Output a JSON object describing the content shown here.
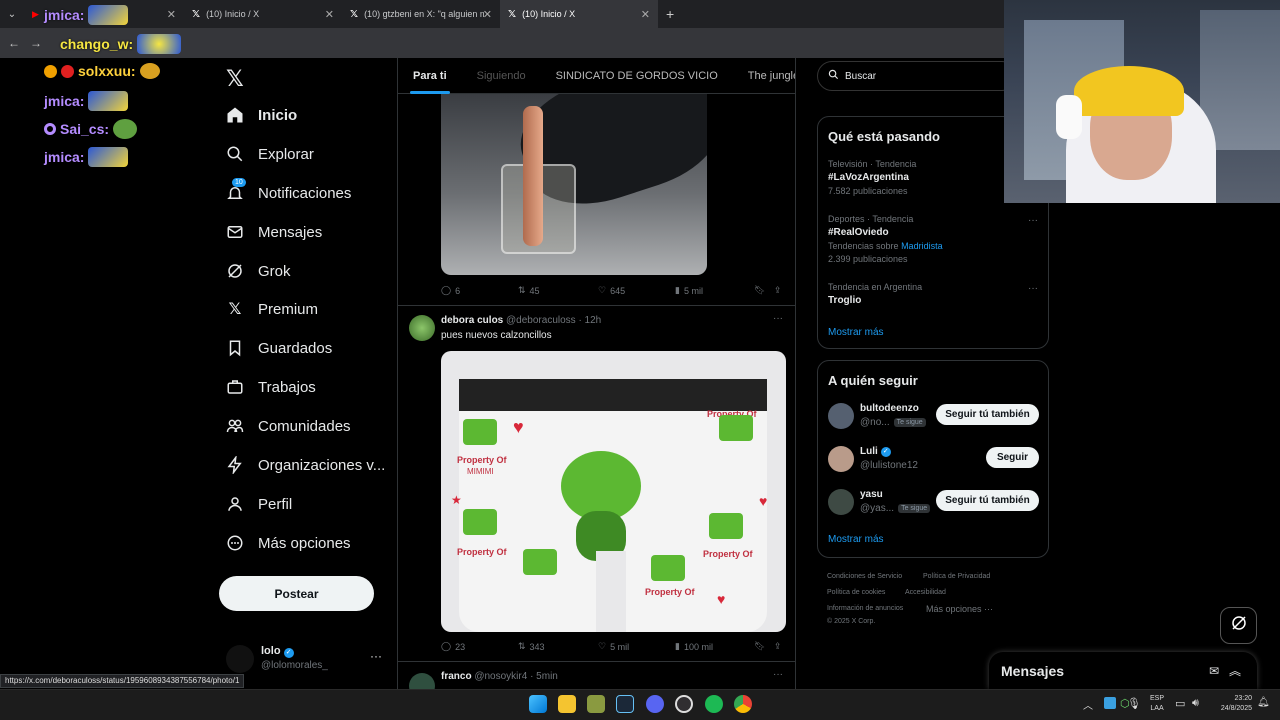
{
  "browser": {
    "tabs": [
      {
        "label": "jmica:"
      },
      {
        "label": "(10) Inicio / X"
      },
      {
        "label": "(10) gtzbeni en X: \"q alguien m"
      },
      {
        "label": "(10) Inicio / X"
      }
    ],
    "status_url": "https://x.com/deboraculoss/status/1959608934387556784/photo/1"
  },
  "chat": [
    {
      "user": "jmica:",
      "color": "#b48cff"
    },
    {
      "user": "chango_w:",
      "color": "#f5e642"
    },
    {
      "user": "solxxuu:",
      "color": "#ffd23d"
    },
    {
      "user": "jmica:",
      "color": "#b48cff"
    },
    {
      "user": "Sai_cs:",
      "color": "#b48cff"
    },
    {
      "user": "jmica:",
      "color": "#b48cff"
    }
  ],
  "sidebar": {
    "items": [
      {
        "label": "Inicio",
        "icon": "home-icon"
      },
      {
        "label": "Explorar",
        "icon": "search-icon"
      },
      {
        "label": "Notificaciones",
        "icon": "bell-icon",
        "badge": "10"
      },
      {
        "label": "Mensajes",
        "icon": "mail-icon"
      },
      {
        "label": "Grok",
        "icon": "grok-icon"
      },
      {
        "label": "Premium",
        "icon": "x-icon"
      },
      {
        "label": "Guardados",
        "icon": "bookmark-icon"
      },
      {
        "label": "Trabajos",
        "icon": "briefcase-icon"
      },
      {
        "label": "Comunidades",
        "icon": "people-icon"
      },
      {
        "label": "Organizaciones v...",
        "icon": "bolt-icon"
      },
      {
        "label": "Perfil",
        "icon": "person-icon"
      },
      {
        "label": "Más opciones",
        "icon": "more-icon"
      }
    ],
    "post_label": "Postear",
    "account": {
      "name": "lolo",
      "handle": "@lolomorales_"
    }
  },
  "feed": {
    "tabs": [
      "Para ti",
      "Siguiendo",
      "SINDICATO DE GORDOS VICIO",
      "The jungle"
    ],
    "post1_actions": {
      "replies": "6",
      "reposts": "45",
      "likes": "645",
      "views": "5 mil"
    },
    "post2": {
      "name": "debora culos",
      "handle": "@deboraculoss",
      "time": "· 12h",
      "text": "pues nuevos calzoncillos",
      "actions": {
        "replies": "23",
        "reposts": "343",
        "likes": "5 mil",
        "views": "100 mil"
      },
      "image_text": [
        "Property Of",
        "MIMIMI",
        "Property Of",
        "Property Of",
        "Property Of",
        "Property Of"
      ]
    },
    "post3": {
      "name": "franco",
      "handle": "@nosoykir4",
      "time": "· 5min"
    }
  },
  "right": {
    "search_placeholder": "Buscar",
    "trending": {
      "title": "Qué está pasando",
      "items": [
        {
          "context": "Televisión · Tendencia",
          "topic": "#LaVozArgentina",
          "count": "7.582 publicaciones"
        },
        {
          "context": "Deportes · Tendencia",
          "topic": "#RealOviedo",
          "extra_prefix": "Tendencias sobre",
          "extra_link": "Madridista",
          "count": "2.399 publicaciones"
        },
        {
          "context": "Tendencia en Argentina",
          "topic": "Troglio"
        }
      ],
      "more": "Mostrar más"
    },
    "who_to_follow": {
      "title": "A quién seguir",
      "users": [
        {
          "name": "bultodeenzo",
          "handle": "@no...",
          "badge": "Te sigue",
          "button": "Seguir tú también"
        },
        {
          "name": "Luli",
          "handle": "@lulistone12",
          "button": "Seguir"
        },
        {
          "name": "yasu",
          "handle": "@yas...",
          "badge": "Te sigue",
          "button": "Seguir tú también"
        }
      ],
      "more": "Mostrar más"
    },
    "footer": [
      "Condiciones de Servicio",
      "Política de Privacidad",
      "Política de cookies",
      "Accesibilidad",
      "Información de anuncios",
      "Más opciones ···",
      "© 2025 X Corp."
    ],
    "messages_label": "Mensajes"
  },
  "taskbar": {
    "lang": "ESP",
    "lang2": "LAA",
    "time": "23:20",
    "date": "24/8/2025"
  },
  "colors": {
    "accent": "#1d9bf0",
    "bg": "#000000",
    "border": "#2f3336"
  }
}
